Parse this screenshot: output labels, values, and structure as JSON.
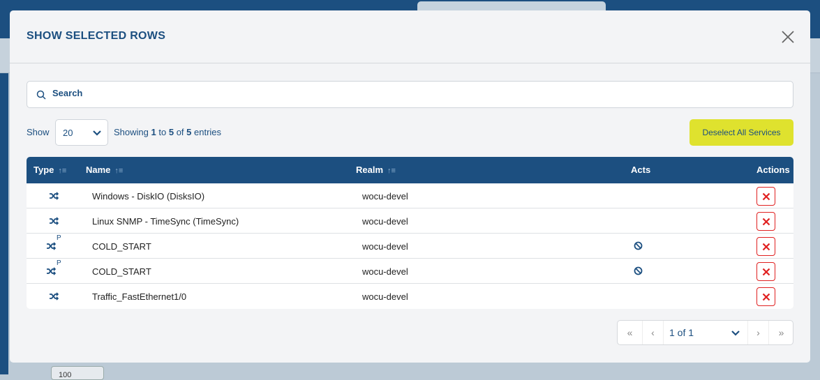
{
  "modal": {
    "title": "SHOW SELECTED ROWS",
    "close_icon": "close-icon"
  },
  "search": {
    "placeholder": "Search",
    "value": ""
  },
  "length": {
    "show_label": "Show",
    "selected": "20"
  },
  "info": {
    "prefix": "Showing",
    "from": "1",
    "to_word": "to",
    "to": "5",
    "of_word": "of",
    "total": "5",
    "suffix": "entries"
  },
  "deselect_label": "Deselect All Services",
  "colors": {
    "primary": "#1c4f80",
    "accent": "#dfe22e",
    "danger": "#e02020"
  },
  "columns": {
    "type": "Type",
    "name": "Name",
    "realm": "Realm",
    "acts": "Acts",
    "actions": "Actions"
  },
  "rows": [
    {
      "name": "Windows - DiskIO (DisksIO)",
      "realm": "wocu-devel",
      "p": "",
      "acts": ""
    },
    {
      "name": "Linux SNMP - TimeSync (TimeSync)",
      "realm": "wocu-devel",
      "p": "",
      "acts": ""
    },
    {
      "name": "COLD_START",
      "realm": "wocu-devel",
      "p": "P",
      "acts": "ban-icon"
    },
    {
      "name": "COLD_START",
      "realm": "wocu-devel",
      "p": "P",
      "acts": "ban-icon"
    },
    {
      "name": "Traffic_FastEthernet1/0",
      "realm": "wocu-devel",
      "p": "",
      "acts": ""
    }
  ],
  "pager": {
    "label": "1 of 1"
  },
  "background": {
    "button": "100"
  }
}
